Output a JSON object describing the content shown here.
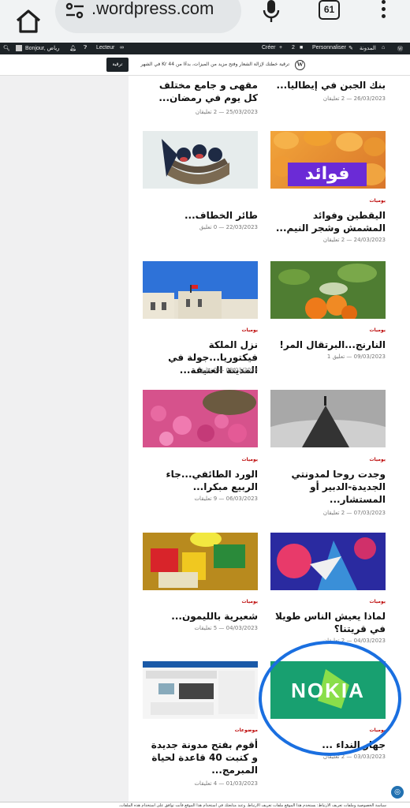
{
  "browser": {
    "url": ".wordpress.com",
    "tab_count": "61"
  },
  "adminbar": {
    "my_site": "المدونة",
    "customize": "Personnaliser",
    "comments": "2",
    "create": "Créer",
    "reader": "Lecteur",
    "greeting": "Bonjour, رياض"
  },
  "notice": {
    "button": "ترقية",
    "text": "ترقية خطتك لإزالة الشعار وفتح مزيد من الميزات، بدءًا من Kr 44 في الشهر"
  },
  "posts": [
    {
      "cat": "",
      "title": "بنك الجبن في إيطاليا...",
      "meta": "26/03/2023 — 2 تعليقان"
    },
    {
      "cat": "",
      "title": "مقهى و جامع مختلف كل يوم في رمضان...",
      "meta": "25/03/2023 — 2 تعليقان"
    },
    {
      "cat": "يوميات",
      "title": "اليقطين وفوائد المشمش وشجر النيم...",
      "meta": "24/03/2023 — 2 تعليقان"
    },
    {
      "cat": "",
      "title": "طائر الخطاف...",
      "meta": "22/03/2023 — 0 تعليق"
    },
    {
      "cat": "يوميات",
      "title": "النارنج...البرتقال المر!",
      "meta": "09/03/2023 — تعليق 1"
    },
    {
      "cat": "يوميات",
      "title": "نزل الملكة فيكتوريا...جولة في المدينة العتيقة...",
      "meta": "09/03/2023 — 0 تعليق"
    },
    {
      "cat": "يوميات",
      "title": "وجدت روحا لمدونتي الجديدة-الدبير أو المستشار...",
      "meta": "07/03/2023 — 2 تعليقان"
    },
    {
      "cat": "يوميات",
      "title": "الورد الطائفي...جاء الربيع مبكرا...",
      "meta": "06/03/2023 — 9 تعليقات"
    },
    {
      "cat": "يوميات",
      "title": "لماذا يعيش الناس طويلا في قريتنا؟",
      "meta": "04/03/2023 — 2 تعليقان"
    },
    {
      "cat": "يوميات",
      "title": "شعيرية بالليمون...",
      "meta": "04/03/2023 — 5 تعليقات"
    },
    {
      "cat": "يوميات",
      "title": "جهاز النداء ...",
      "meta": "03/03/2023 — 2 تعليقان"
    },
    {
      "cat": "موضوعات",
      "title": "أقوم بفتح مدونة جديدة و كتبت 40 قاعدة لحياة المبرمج...",
      "meta": "01/03/2023 — 4 تعليقات"
    }
  ],
  "thumbs": {
    "fawaid": "فوائد",
    "nokia": "NOKIA"
  },
  "cookie": "سياسة الخصوصية وملفات تعريف الارتباط: يستخدم هذا الموقع ملفات تعريف الارتباط. وعند متابعتك في استخدام هذا الموقع فأنت توافق على استخدام هذه الملفات."
}
